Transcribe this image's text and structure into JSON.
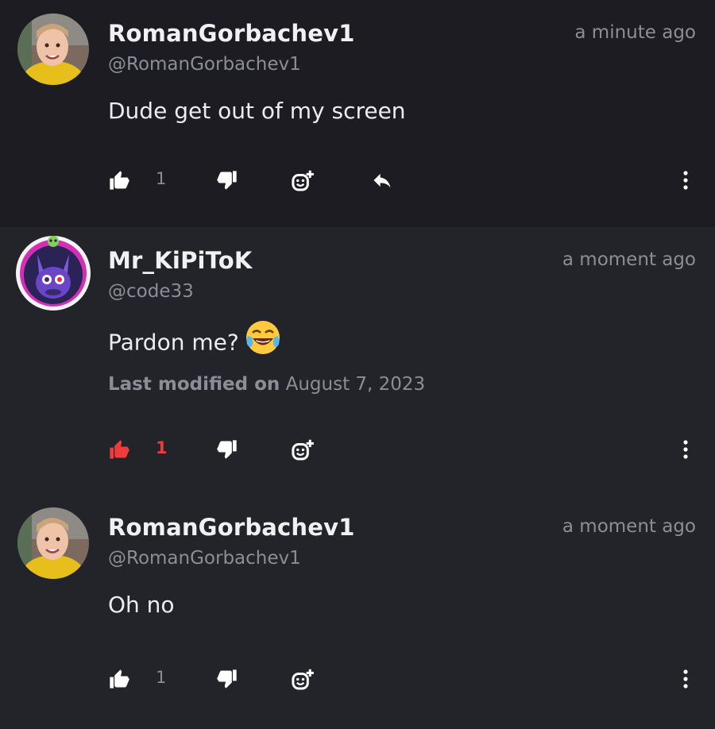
{
  "comments": [
    {
      "username": "RomanGorbachev1",
      "handle": "@RomanGorbachev1",
      "time": "a minute ago",
      "text": "Dude get out of my screen",
      "likes": "1",
      "liked": false,
      "has_reply": true
    },
    {
      "username": "Mr_KiPiToK",
      "handle": "@code33",
      "time": "a moment ago",
      "text": "Pardon me?",
      "emoji": "face-with-tears-of-joy",
      "modified_label": "Last modified on",
      "modified_date": "August 7, 2023",
      "likes": "1",
      "liked": true,
      "has_reply": false
    },
    {
      "username": "RomanGorbachev1",
      "handle": "@RomanGorbachev1",
      "time": "a moment ago",
      "text": "Oh no",
      "likes": "1",
      "liked": false,
      "has_reply": false
    }
  ],
  "colors": {
    "liked": "#ef3b3b",
    "icon": "#ffffff",
    "muted": "#8d8d97"
  },
  "icons": {
    "like": "thumbs-up-icon",
    "dislike": "thumbs-down-icon",
    "react": "add-reaction-icon",
    "reply": "reply-icon",
    "more": "more-vertical-icon"
  }
}
